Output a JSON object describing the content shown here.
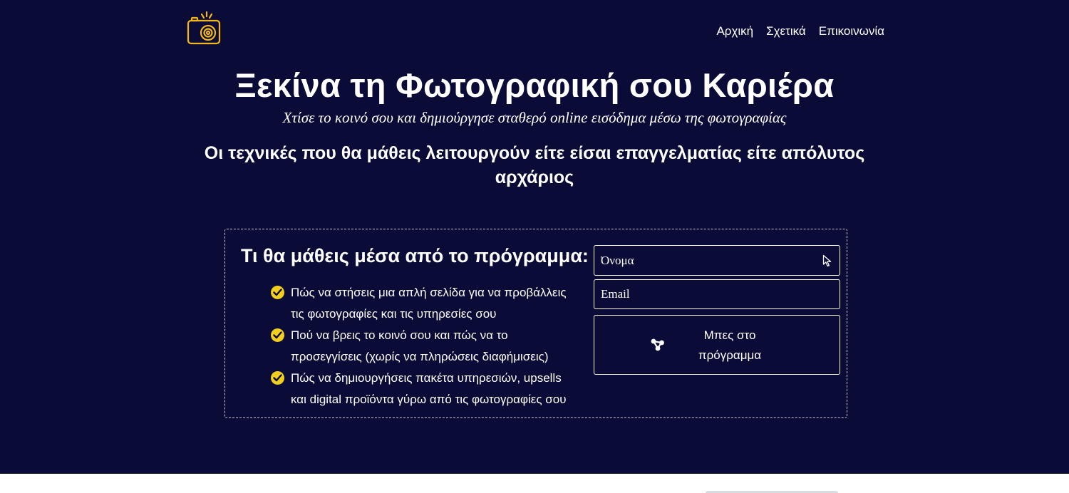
{
  "nav": {
    "items": [
      "Αρχική",
      "Σχετικά",
      "Επικοινωνία"
    ]
  },
  "hero": {
    "title": "Ξεκίνα τη Φωτογραφική σου Καριέρα",
    "subtitle": "Χτίσε το κοινό σου και δημιούργησε σταθερό online εισόδημα μέσω της φωτογραφίας",
    "tagline": "Οι τεχνικές που θα μάθεις λειτουργούν είτε είσαι επαγγελματίας είτε απόλυτος αρχάριος"
  },
  "program": {
    "heading": "Τι θα μάθεις μέσα από το πρόγραμμα:",
    "features": [
      "Πώς να στήσεις μια απλή σελίδα για να προβάλλεις τις φωτογραφίες και τις υπηρεσίες σου",
      "Πού να βρεις το κοινό σου και πώς να το προσεγγίσεις (χωρίς να πληρώσεις διαφήμισεις)",
      "Πώς να δημιουργήσεις πακέτα υπηρεσιών, upsells και digital προϊόντα γύρω από τις φωτογραφίες σου"
    ]
  },
  "form": {
    "name_placeholder": "Όνομα",
    "email_placeholder": "Email",
    "submit_label": "Μπες στο πρόγραμμα"
  },
  "colors": {
    "background": "#0b0b38",
    "accent": "#f2cf1f",
    "text": "#ffffff"
  },
  "icons": [
    "camera-logo-icon",
    "check-circle-icon",
    "cursor-icon",
    "share-icon"
  ]
}
